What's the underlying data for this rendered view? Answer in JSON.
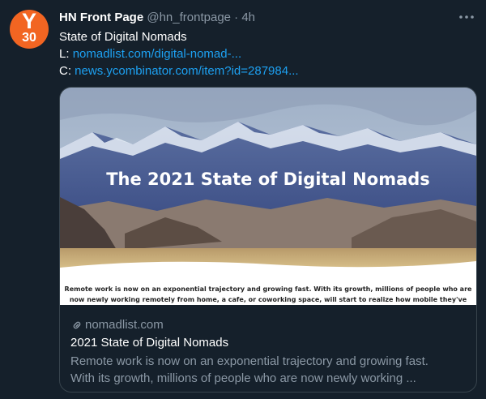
{
  "avatar": {
    "letter": "Y",
    "number": "30",
    "color": "#f26522"
  },
  "header": {
    "name": "HN Front Page",
    "handle": "@hn_frontpage",
    "dot": " · ",
    "time": "4h"
  },
  "tweet": {
    "title": "State of Digital Nomads",
    "link_prefix": "L: ",
    "link_url": "nomadlist.com/digital-nomad-...",
    "comments_prefix": "C: ",
    "comments_url": "news.ycombinator.com/item?id=287984..."
  },
  "card": {
    "image_heading": "The 2021 State of Digital Nomads",
    "image_body_line1": "Remote work is now on an exponential trajectory and growing fast. With its growth, millions of people who are",
    "image_body_line2": "now newly working remotely from home, a cafe, or coworking space, will start to realize how mobile they've",
    "domain": "nomadlist.com",
    "title": "2021 State of Digital Nomads",
    "description_line1": "Remote work is now on an exponential trajectory and growing fast.",
    "description_line2": "With its growth, millions of people who are now newly working ..."
  },
  "icons": {
    "more": "more-horizontal-icon",
    "link": "link-icon"
  },
  "colors": {
    "background": "#15202b",
    "link": "#1da1f2",
    "muted": "#8b98a5",
    "border": "#38444d"
  }
}
